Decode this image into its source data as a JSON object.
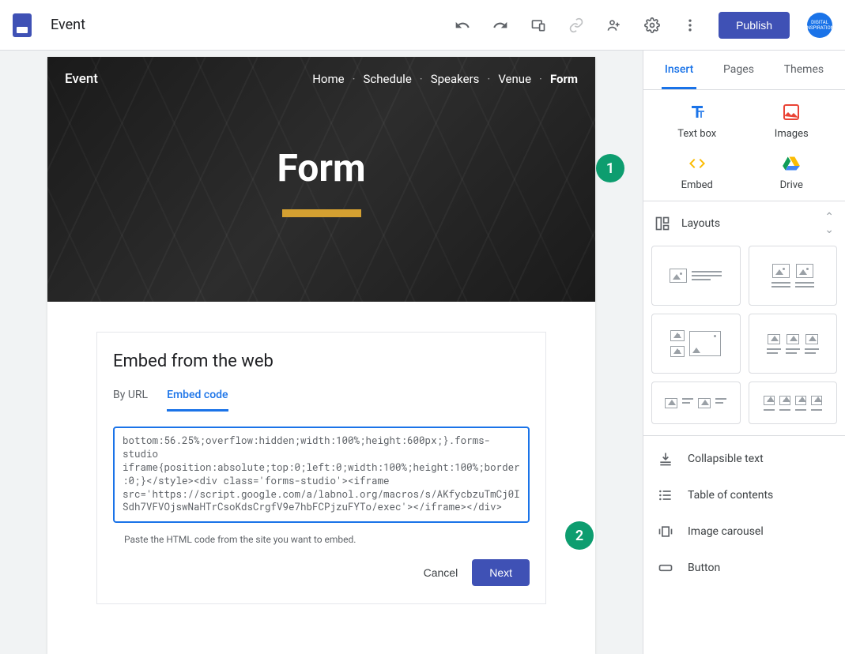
{
  "toolbar": {
    "doc_title": "Event",
    "publish_label": "Publish"
  },
  "site": {
    "name": "Event",
    "nav": [
      "Home",
      "Schedule",
      "Speakers",
      "Venue",
      "Form"
    ],
    "active_nav": "Form",
    "hero_title": "Form"
  },
  "embed_dialog": {
    "title": "Embed from the web",
    "tabs": {
      "by_url": "By URL",
      "embed_code": "Embed code"
    },
    "code": "bottom:56.25%;overflow:hidden;width:100%;height:600px;}.forms-studio iframe{position:absolute;top:0;left:0;width:100%;height:100%;border:0;}</style><div class='forms-studio'><iframe src='https://script.google.com/a/labnol.org/macros/s/AKfycbzuTmCj0ISdh7VFVOjswNaHTrCsoKdsCrgfV9e7hbFCPjzuFYTo/exec'></iframe></div>",
    "hint": "Paste the HTML code from the site you want to embed.",
    "cancel": "Cancel",
    "next": "Next"
  },
  "sidebar": {
    "tabs": {
      "insert": "Insert",
      "pages": "Pages",
      "themes": "Themes"
    },
    "insert_items": {
      "text_box": "Text box",
      "images": "Images",
      "embed": "Embed",
      "drive": "Drive"
    },
    "layouts_title": "Layouts",
    "list": {
      "collapsible": "Collapsible text",
      "toc": "Table of contents",
      "carousel": "Image carousel",
      "button": "Button"
    }
  },
  "annotations": {
    "step1": "1",
    "step2": "2"
  }
}
